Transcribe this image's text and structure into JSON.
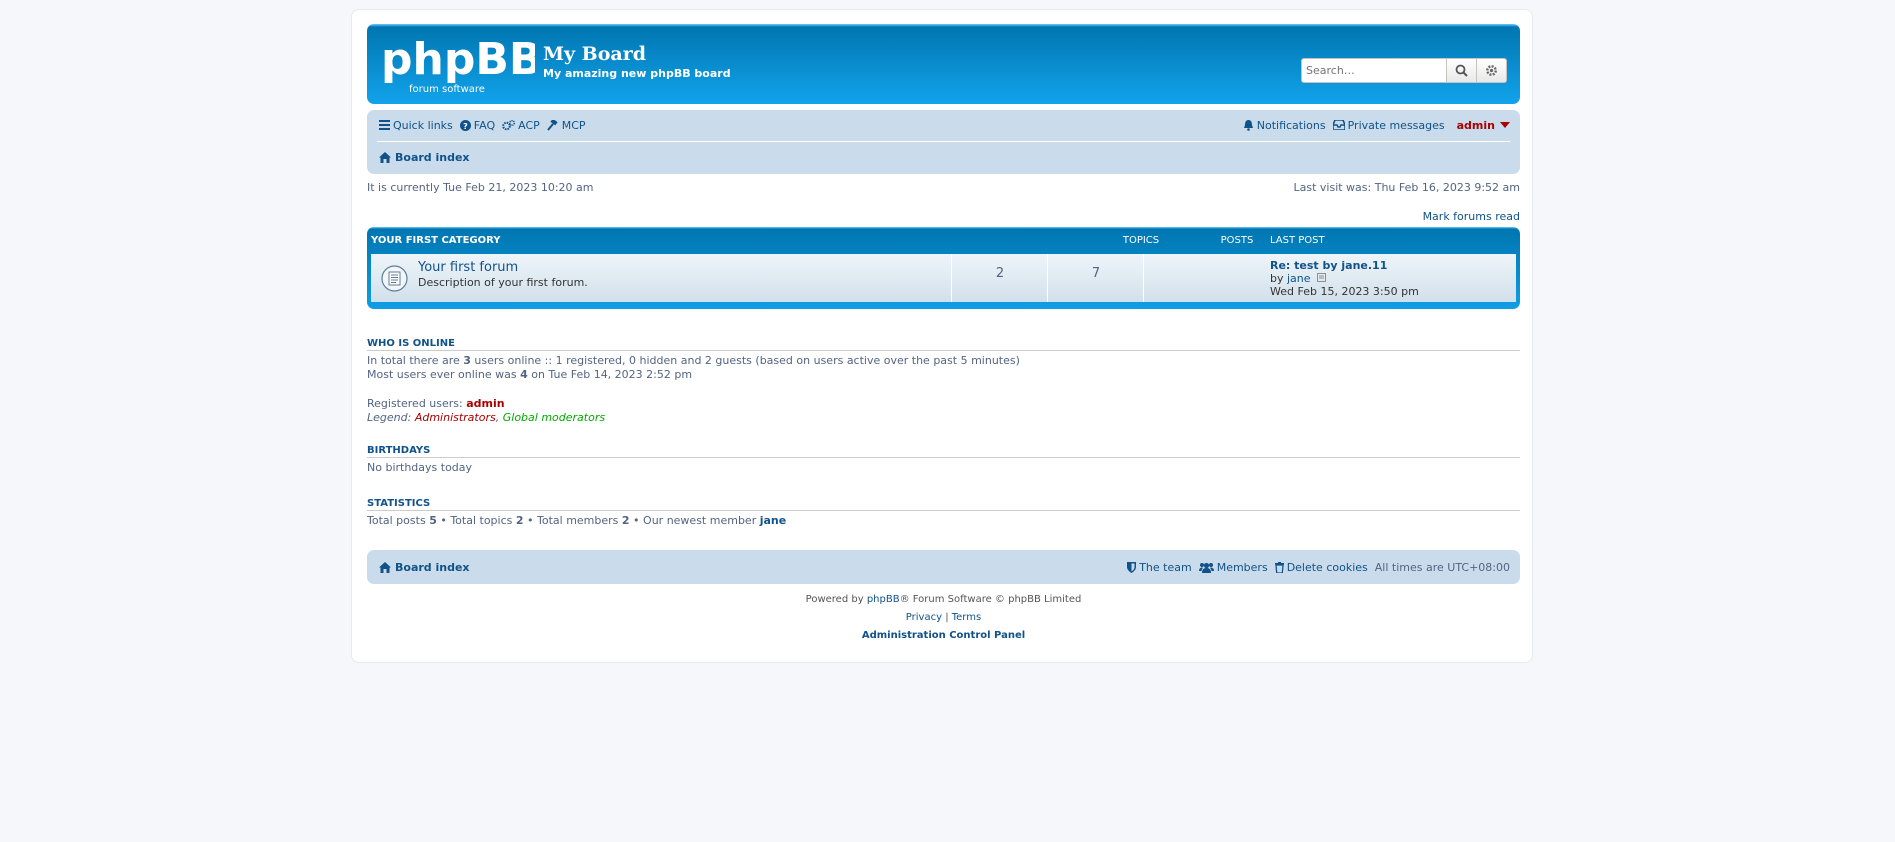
{
  "header": {
    "site_title": "My Board",
    "site_description": "My amazing new phpBB board",
    "logo_text": "phpBB",
    "logo_subtext": "forum software",
    "search_placeholder": "Search…"
  },
  "navbar": {
    "quick_links": "Quick links",
    "faq": "FAQ",
    "acp": "ACP",
    "mcp": "MCP",
    "notifications": "Notifications",
    "private_messages": "Private messages",
    "username": "admin",
    "breadcrumb": "Board index"
  },
  "timeline": {
    "current_time": "It is currently Tue Feb 21, 2023 10:20 am",
    "last_visit": "Last visit was: Thu Feb 16, 2023 9:52 am",
    "mark_read": "Mark forums read"
  },
  "forum_table": {
    "category": "YOUR FIRST CATEGORY",
    "col_topics": "TOPICS",
    "col_posts": "POSTS",
    "col_last_post": "LAST POST",
    "rows": [
      {
        "title": "Your first forum",
        "description": "Description of your first forum.",
        "topics": "2",
        "posts": "7",
        "last_post_title": "Re: test by jane.11",
        "last_post_by_prefix": "by",
        "last_post_author": "jane",
        "last_post_time": "Wed Feb 15, 2023 3:50 pm"
      }
    ]
  },
  "who_is_online": {
    "title": "WHO IS ONLINE",
    "line1_a": "In total there are",
    "line1_count": "3",
    "line1_b": "users online :: 1 registered, 0 hidden and 2 guests (based on users active over the past 5 minutes)",
    "line2_a": "Most users ever online was",
    "line2_count": "4",
    "line2_b": "on Tue Feb 14, 2023 2:52 pm",
    "registered_label": "Registered users:",
    "registered_user": "admin",
    "legend_label": "Legend:",
    "legend_admins": "Administrators",
    "legend_mods": "Global moderators"
  },
  "birthdays": {
    "title": "BIRTHDAYS",
    "text": "No birthdays today"
  },
  "statistics": {
    "title": "STATISTICS",
    "total_posts_label": "Total posts",
    "total_posts": "5",
    "total_topics_label": "Total topics",
    "total_topics": "2",
    "total_members_label": "Total members",
    "total_members": "2",
    "newest_label": "Our newest member",
    "newest_member": "jane"
  },
  "footer_nav": {
    "breadcrumb": "Board index",
    "the_team": "The team",
    "members": "Members",
    "delete_cookies": "Delete cookies",
    "timezone": "All times are UTC+08:00"
  },
  "copyright": {
    "powered_prefix": "Powered by",
    "phpbb": "phpBB",
    "powered_suffix": "® Forum Software © phpBB Limited",
    "privacy": "Privacy",
    "separator": "|",
    "terms": "Terms",
    "acp": "Administration Control Panel"
  },
  "colors": {
    "link": "#105289",
    "admin_red": "#aa0000",
    "moderator_green": "#00aa00",
    "header_blue": "#12a3eb",
    "navbar_bg": "#cadceb"
  }
}
